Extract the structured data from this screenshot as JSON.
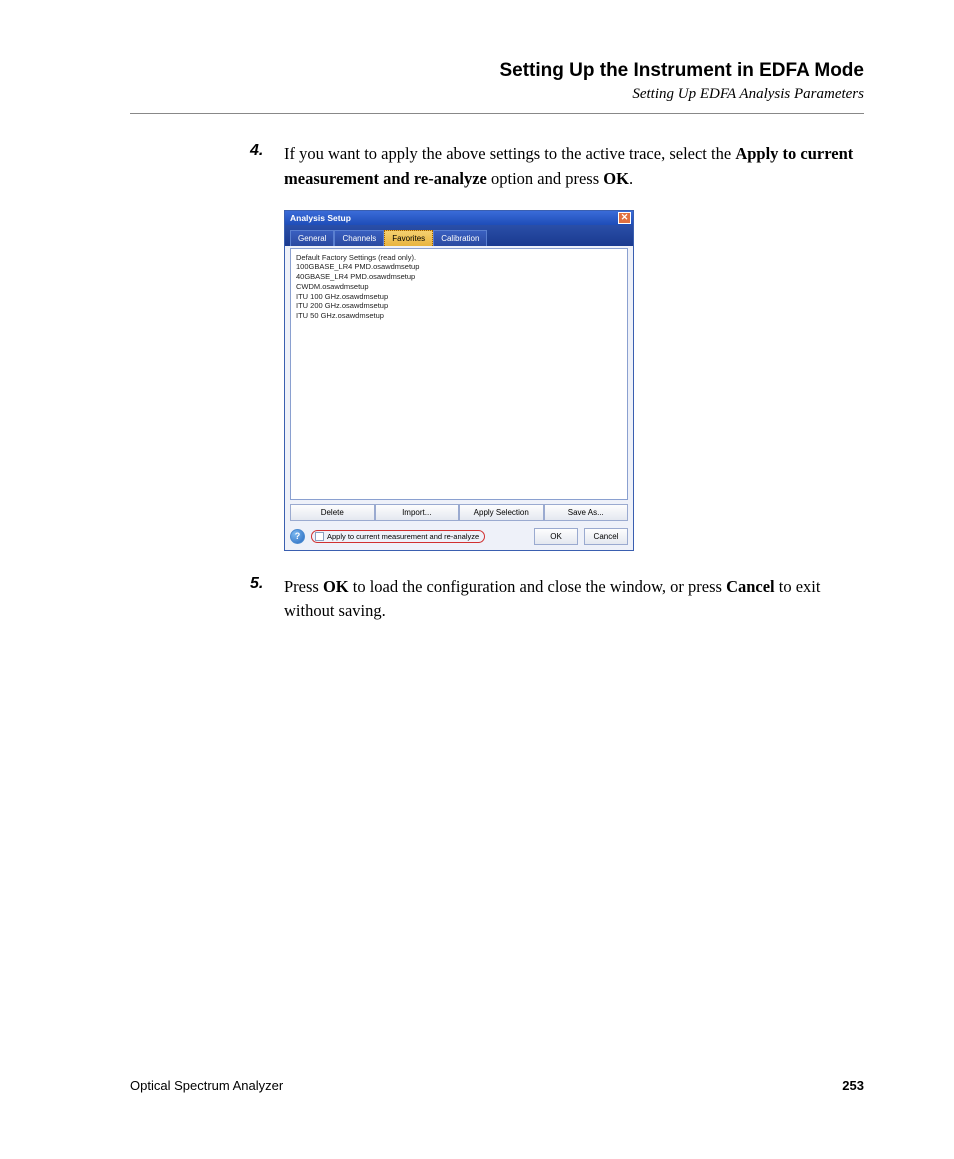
{
  "header": {
    "title": "Setting Up the Instrument in EDFA Mode",
    "subtitle": "Setting Up EDFA Analysis Parameters"
  },
  "steps": {
    "s4": {
      "num": "4.",
      "t1": "If you want to apply the above settings to the active trace, select the ",
      "t2": "Apply to current measurement and re-analyze",
      "t3": " option and press ",
      "t4": "OK",
      "t5": "."
    },
    "s5": {
      "num": "5.",
      "t1": "Press ",
      "t2": "OK",
      "t3": " to load the configuration and close the window, or press ",
      "t4": "Cancel",
      "t5": " to exit without saving."
    }
  },
  "dialog": {
    "title": "Analysis Setup",
    "tabs": {
      "general": "General",
      "channels": "Channels",
      "favorites": "Favorites",
      "calibration": "Calibration"
    },
    "list": {
      "i0": "Default Factory Settings (read only).",
      "i1": "100GBASE_LR4 PMD.osawdmsetup",
      "i2": "40GBASE_LR4 PMD.osawdmsetup",
      "i3": "CWDM.osawdmsetup",
      "i4": "ITU 100 GHz.osawdmsetup",
      "i5": "ITU 200 GHz.osawdmsetup",
      "i6": "ITU 50 GHz.osawdmsetup"
    },
    "buttons": {
      "delete": "Delete",
      "import": "Import...",
      "apply_selection": "Apply Selection",
      "save_as": "Save As..."
    },
    "checkbox": "Apply to current measurement and re-analyze",
    "ok": "OK",
    "cancel": "Cancel"
  },
  "footer": {
    "left": "Optical Spectrum Analyzer",
    "right": "253"
  }
}
